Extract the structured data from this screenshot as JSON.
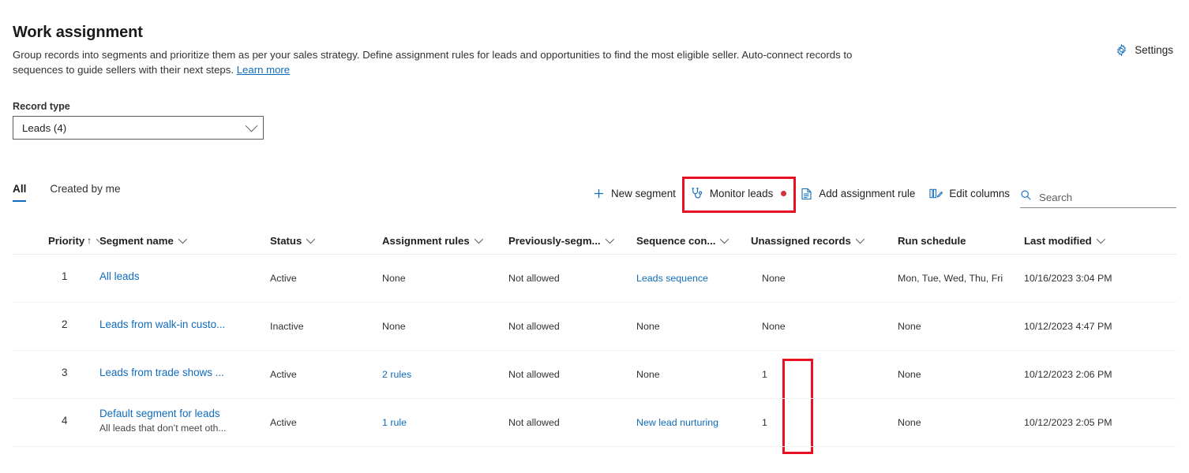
{
  "header": {
    "title": "Work assignment",
    "description_part1": "Group records into segments and prioritize them as per your sales strategy. Define assignment rules for leads and opportunities to find the most eligible seller. Auto-connect records to sequences to guide sellers with their next steps. ",
    "learn_more": "Learn more",
    "settings_label": "Settings",
    "settings_icon": "gear-icon"
  },
  "record_type": {
    "label": "Record type",
    "value": "Leads (4)"
  },
  "pivots": [
    {
      "label": "All",
      "selected": true
    },
    {
      "label": "Created by me",
      "selected": false
    }
  ],
  "commands": [
    {
      "label": "New segment",
      "icon": "plus-icon"
    },
    {
      "label": "Monitor leads",
      "icon": "stethoscope-icon",
      "badge": "red-dot",
      "highlighted": true
    },
    {
      "label": "Add assignment rule",
      "icon": "document-icon"
    },
    {
      "label": "Edit columns",
      "icon": "edit-columns-icon"
    }
  ],
  "search": {
    "placeholder": "Search",
    "icon": "search-icon"
  },
  "table": {
    "columns": [
      {
        "label": "Priority",
        "sort": "↑",
        "menu": true
      },
      {
        "label": "Segment name",
        "menu": true
      },
      {
        "label": "Status",
        "menu": true
      },
      {
        "label": "Assignment rules",
        "menu": true
      },
      {
        "label": "Previously-segm...",
        "menu": true
      },
      {
        "label": "Sequence con...",
        "menu": true
      },
      {
        "label": "Unassigned records",
        "menu": true
      },
      {
        "label": "Run schedule",
        "menu": false
      },
      {
        "label": "Last modified",
        "menu": true
      }
    ],
    "rows": [
      {
        "priority": "1",
        "segment_name": "All leads",
        "segment_sub": "",
        "status": "Active",
        "assignment_rules": "None",
        "assignment_rules_link": false,
        "previously_segmented": "Not allowed",
        "sequence_connected": "Leads sequence",
        "sequence_connected_link": true,
        "unassigned_records": "None",
        "run_schedule": "Mon, Tue, Wed, Thu, Fri",
        "last_modified": "10/16/2023 3:04 PM"
      },
      {
        "priority": "2",
        "segment_name": "Leads from walk-in custo...",
        "segment_sub": "",
        "status": "Inactive",
        "assignment_rules": "None",
        "assignment_rules_link": false,
        "previously_segmented": "Not allowed",
        "sequence_connected": "None",
        "sequence_connected_link": false,
        "unassigned_records": "None",
        "run_schedule": "None",
        "last_modified": "10/12/2023 4:47 PM"
      },
      {
        "priority": "3",
        "segment_name": "Leads from trade shows ...",
        "segment_sub": "",
        "status": "Active",
        "assignment_rules": "2 rules",
        "assignment_rules_link": true,
        "previously_segmented": "Not allowed",
        "sequence_connected": "None",
        "sequence_connected_link": false,
        "unassigned_records": "1",
        "run_schedule": "None",
        "last_modified": "10/12/2023 2:06 PM"
      },
      {
        "priority": "4",
        "segment_name": "Default segment for leads",
        "segment_sub": "All leads that don’t meet oth...",
        "status": "Active",
        "assignment_rules": "1 rule",
        "assignment_rules_link": true,
        "previously_segmented": "Not allowed",
        "sequence_connected": "New lead nurturing",
        "sequence_connected_link": true,
        "unassigned_records": "1",
        "run_schedule": "None",
        "last_modified": "10/12/2023 2:05 PM"
      }
    ]
  },
  "colors": {
    "accent": "#0f6cbd",
    "highlight": "#e81123",
    "badge": "#d13438"
  }
}
